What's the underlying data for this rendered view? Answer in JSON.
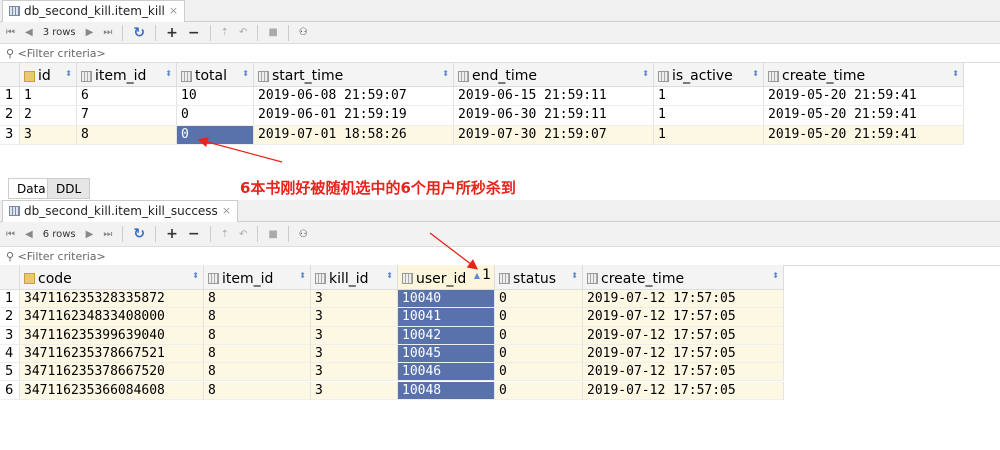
{
  "top": {
    "tab_title": "db_second_kill.item_kill",
    "rows_label": "3 rows",
    "filter_placeholder": "<Filter criteria>",
    "columns": [
      "id",
      "item_id",
      "total",
      "start_time",
      "end_time",
      "is_active",
      "create_time"
    ],
    "rows": [
      [
        "1",
        "1",
        "6",
        "10",
        "2019-06-08 21:59:07",
        "2019-06-15 21:59:11",
        "1",
        "2019-05-20 21:59:41"
      ],
      [
        "2",
        "2",
        "7",
        "0",
        "2019-06-01 21:59:19",
        "2019-06-30 21:59:11",
        "1",
        "2019-05-20 21:59:41"
      ],
      [
        "3",
        "3",
        "8",
        "0",
        "2019-07-01 18:58:26",
        "2019-07-30 21:59:07",
        "1",
        "2019-05-20 21:59:41"
      ]
    ]
  },
  "bottom_tabs": [
    "Data",
    "DDL"
  ],
  "annotation": "6本书刚好被随机选中的6个用户所秒杀到",
  "bottom": {
    "tab_title": "db_second_kill.item_kill_success",
    "rows_label": "6 rows",
    "filter_placeholder": "<Filter criteria>",
    "columns": [
      "code",
      "item_id",
      "kill_id",
      "user_id",
      "status",
      "create_time"
    ],
    "sort_index": "1",
    "rows": [
      [
        "1",
        "347116235328335872",
        "8",
        "3",
        "10040",
        "0",
        "2019-07-12 17:57:05"
      ],
      [
        "2",
        "347116234833408000",
        "8",
        "3",
        "10041",
        "0",
        "2019-07-12 17:57:05"
      ],
      [
        "3",
        "347116235399639040",
        "8",
        "3",
        "10042",
        "0",
        "2019-07-12 17:57:05"
      ],
      [
        "4",
        "347116235378667521",
        "8",
        "3",
        "10045",
        "0",
        "2019-07-12 17:57:05"
      ],
      [
        "5",
        "347116235378667520",
        "8",
        "3",
        "10046",
        "0",
        "2019-07-12 17:57:05"
      ],
      [
        "6",
        "347116235366084608",
        "8",
        "3",
        "10048",
        "0",
        "2019-07-12 17:57:05"
      ]
    ]
  },
  "colors": {
    "selection": "#5a72ab",
    "annotation": "#e8231a",
    "current_row": "#fdf8e4"
  }
}
